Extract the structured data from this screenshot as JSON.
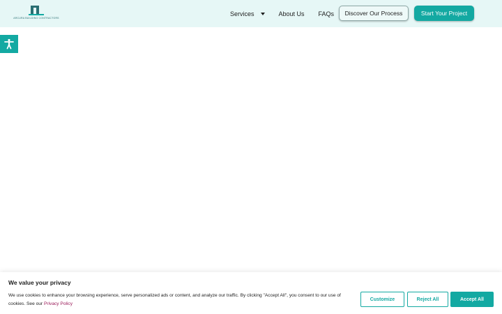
{
  "header": {
    "logo_text": "ARCURA BUILDING CONTRACTORS",
    "nav": {
      "services_label": "Services",
      "about_label": "About Us",
      "faqs_label": "FAQs"
    },
    "discover_label": "Discover Our Process",
    "start_label": "Start Your Project"
  },
  "accessibility": {
    "icon": "accessibility-icon"
  },
  "cookie_banner": {
    "title": "We value your privacy",
    "text": "We use cookies to enhance your browsing experience, serve personalized ads or content, and analyze our traffic. By clicking \"Accept All\", you consent to our use of cookies. See our",
    "policy_link": "Privacy Policy",
    "customize_label": "Customize",
    "reject_label": "Reject All",
    "accept_label": "Accept All"
  },
  "colors": {
    "header_bg": "#e6f7f6",
    "accent": "#13a9a2",
    "link": "#9b1c5a"
  }
}
